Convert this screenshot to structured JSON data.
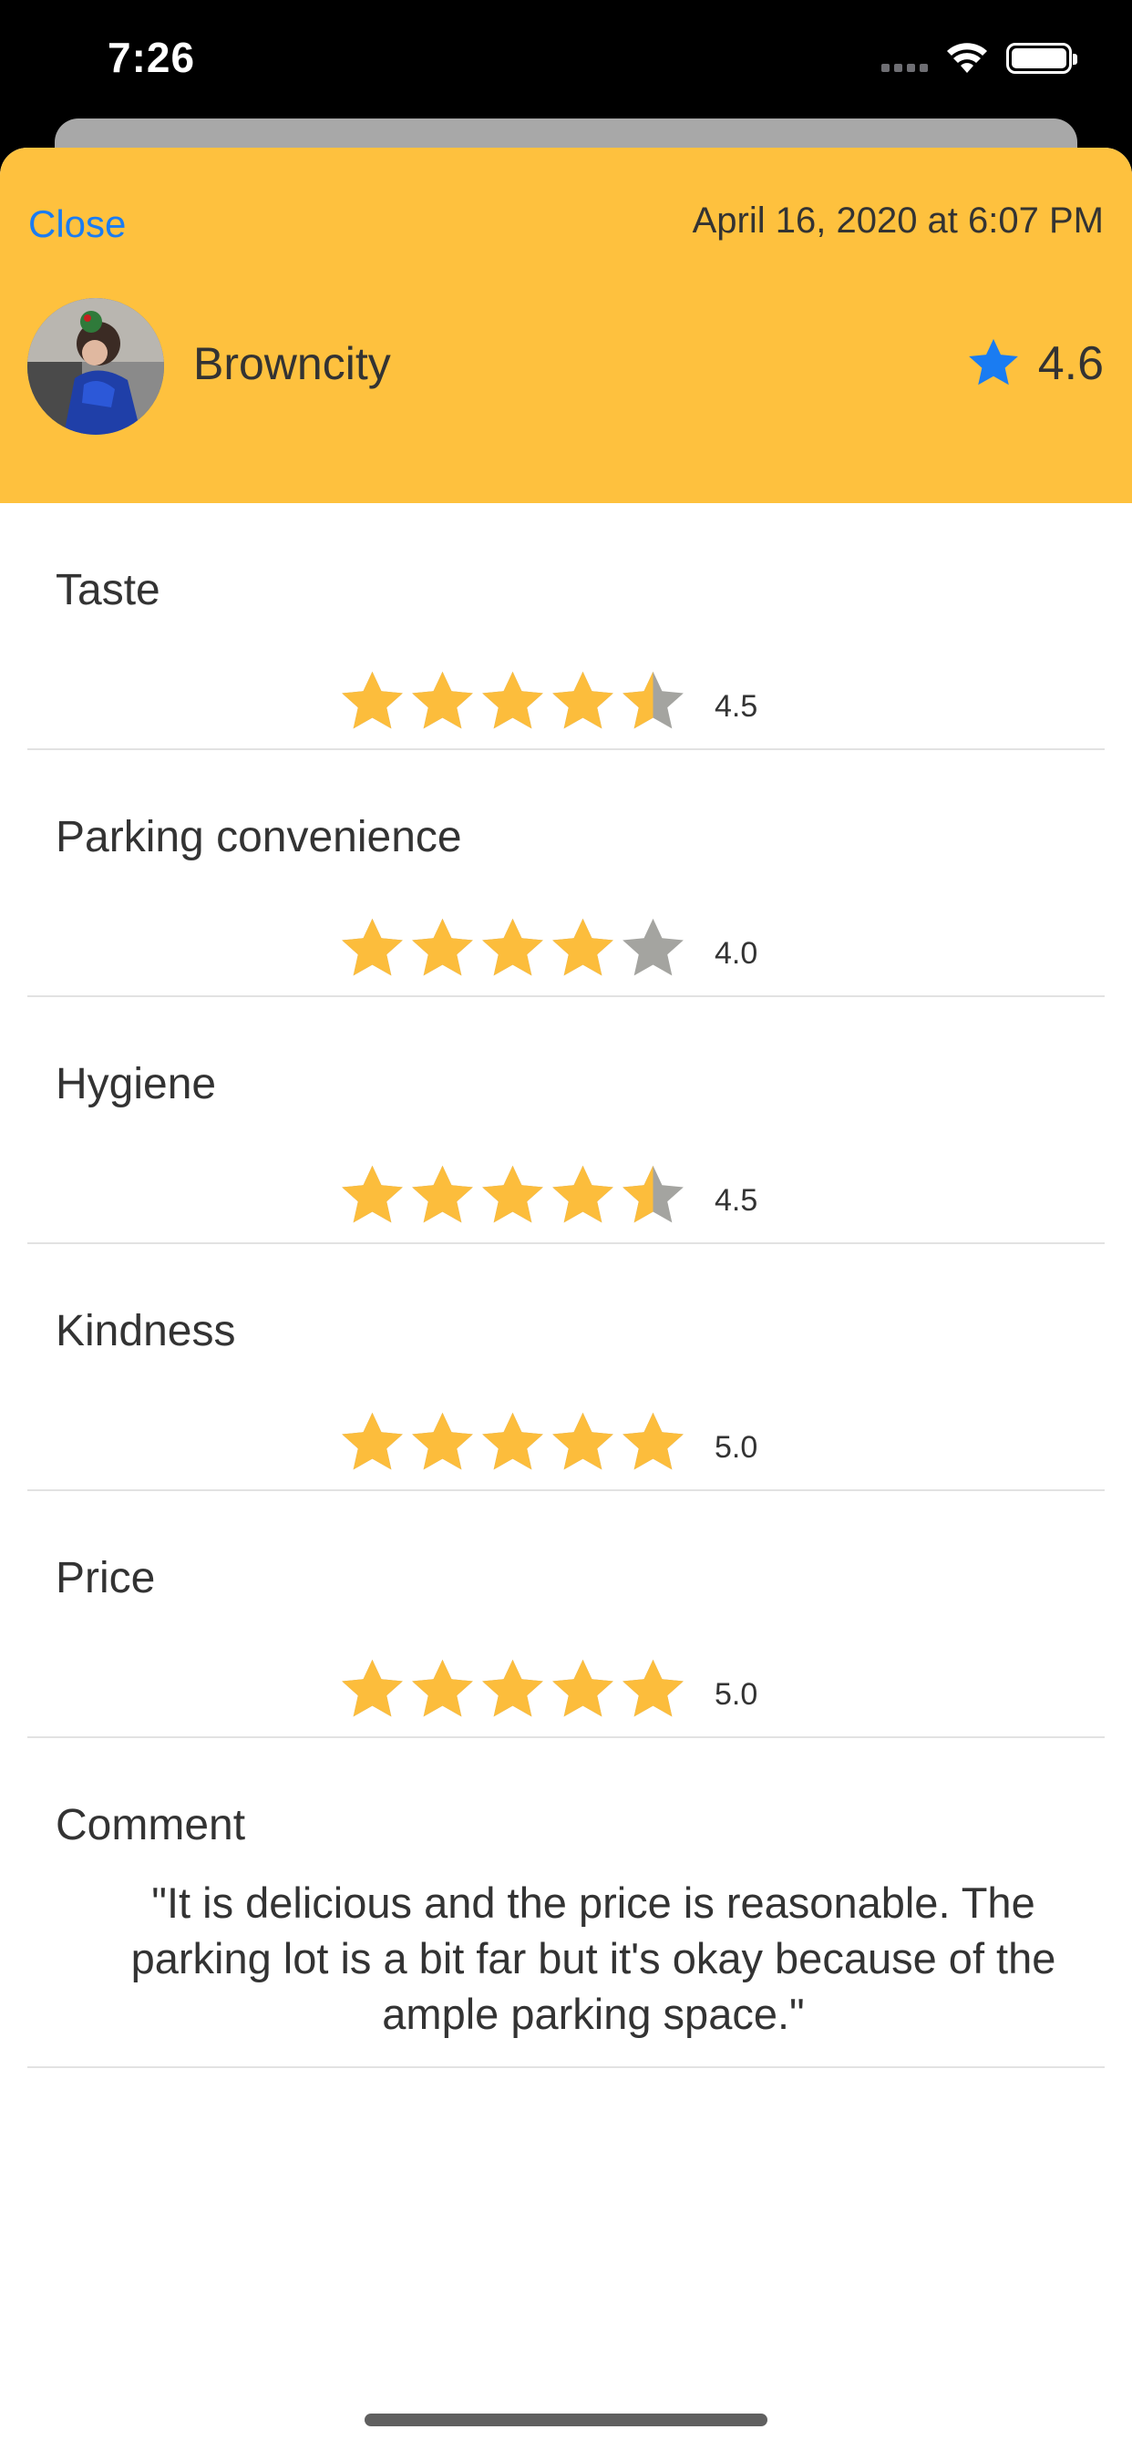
{
  "status_bar": {
    "time": "7:26"
  },
  "header": {
    "close_label": "Close",
    "date": "April 16, 2020 at 6:07 PM",
    "username": "Browncity",
    "overall_rating": "4.6"
  },
  "ratings": [
    {
      "label": "Taste",
      "value": "4.5",
      "score": 4.5
    },
    {
      "label": "Parking convenience",
      "value": "4.0",
      "score": 4.0
    },
    {
      "label": "Hygiene",
      "value": "4.5",
      "score": 4.5
    },
    {
      "label": "Kindness",
      "value": "5.0",
      "score": 5.0
    },
    {
      "label": "Price",
      "value": "5.0",
      "score": 5.0
    }
  ],
  "comment": {
    "label": "Comment",
    "text": "\"It is delicious and the price is reasonable. The parking lot is a bit far but it's okay because of the ample parking space.\""
  },
  "colors": {
    "header_bg": "#fec13e",
    "star_filled": "#fcbd3c",
    "star_empty": "#a4a4a0",
    "accent_blue": "#1a7cf2"
  }
}
